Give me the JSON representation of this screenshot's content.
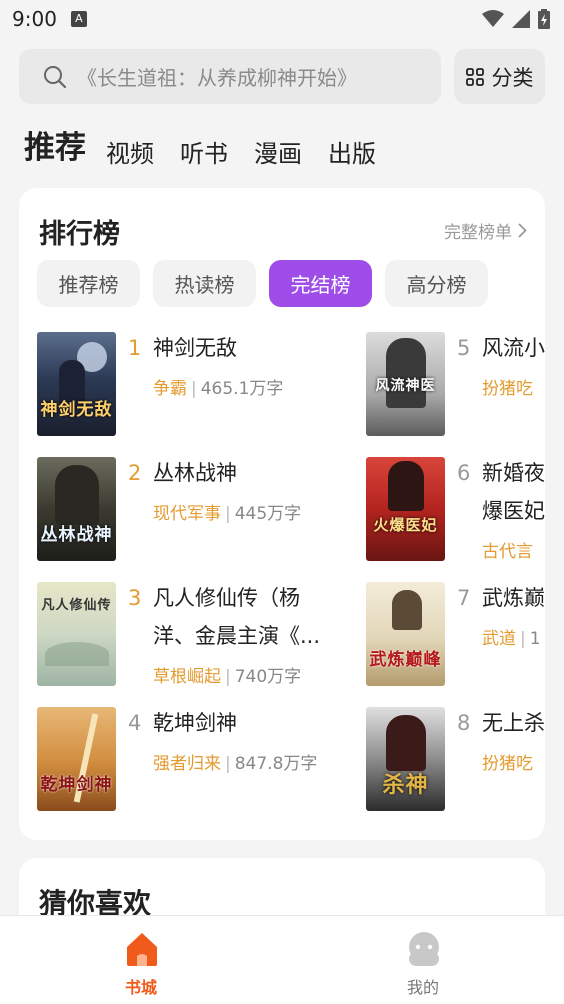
{
  "status_bar": {
    "time": "9:00",
    "notification_icon": "A"
  },
  "search": {
    "placeholder": "《长生道祖：从养成柳神开始》",
    "category_label": "分类"
  },
  "top_tabs": [
    {
      "label": "推荐",
      "active": true
    },
    {
      "label": "视频",
      "active": false
    },
    {
      "label": "听书",
      "active": false
    },
    {
      "label": "漫画",
      "active": false
    },
    {
      "label": "出版",
      "active": false
    }
  ],
  "ranking": {
    "title": "排行榜",
    "more_label": "完整榜单",
    "tabs": [
      {
        "label": "推荐榜",
        "active": false
      },
      {
        "label": "热读榜",
        "active": false
      },
      {
        "label": "完结榜",
        "active": true
      },
      {
        "label": "高分榜",
        "active": false
      }
    ],
    "books": [
      {
        "rank": "1",
        "title": "神剑无敌",
        "title_line2": "",
        "tag": "争霸",
        "count": "465.1万字",
        "cover_text": "神剑无敌"
      },
      {
        "rank": "2",
        "title": "丛林战神",
        "title_line2": "",
        "tag": "现代军事",
        "count": "445万字",
        "cover_text": "丛林战神"
      },
      {
        "rank": "3",
        "title": "凡人修仙传（杨",
        "title_line2": "洋、金晨主演《...",
        "tag": "草根崛起",
        "count": "740万字",
        "cover_text": "凡人修仙传"
      },
      {
        "rank": "4",
        "title": "乾坤剑神",
        "title_line2": "",
        "tag": "强者归来",
        "count": "847.8万字",
        "cover_text": "乾坤剑神"
      },
      {
        "rank": "5",
        "title": "风流小",
        "title_line2": "",
        "tag": "扮猪吃",
        "count": "",
        "cover_text": "风流神医"
      },
      {
        "rank": "6",
        "title": "新婚夜",
        "title_line2": "爆医妃",
        "tag": "古代言",
        "count": "",
        "cover_text": "火爆医妃"
      },
      {
        "rank": "7",
        "title": "武炼巅",
        "title_line2": "",
        "tag": "武道",
        "count": "1",
        "cover_text": "武炼巅峰"
      },
      {
        "rank": "8",
        "title": "无上杀",
        "title_line2": "",
        "tag": "扮猪吃",
        "count": "",
        "cover_text": "杀神"
      }
    ]
  },
  "guess": {
    "title": "猜你喜欢"
  },
  "bottom_nav": [
    {
      "label": "书城",
      "active": true,
      "icon": "home-icon"
    },
    {
      "label": "我的",
      "active": false,
      "icon": "profile-icon"
    }
  ],
  "colors": {
    "accent_purple": "#9e4de8",
    "rank_orange": "#e49b2f",
    "nav_active": "#f05a1a"
  }
}
